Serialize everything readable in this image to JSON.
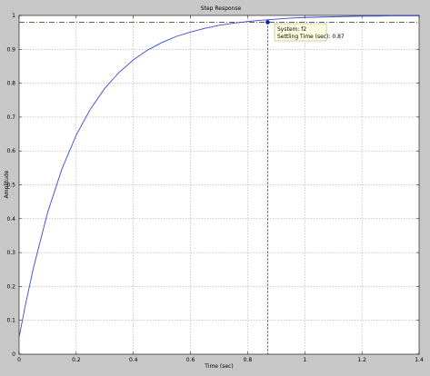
{
  "chart_data": {
    "type": "line",
    "title": "Step Response",
    "xlabel": "Time (sec)",
    "ylabel": "Amplitude",
    "xlim": [
      0,
      1.4
    ],
    "ylim": [
      0,
      1
    ],
    "xticks": [
      0,
      0.2,
      0.4,
      0.6,
      0.8,
      1,
      1.2,
      1.4
    ],
    "xtick_labels": [
      "0",
      "0.2",
      "0.4",
      "0.6",
      "0.8",
      "1",
      "1.2",
      "1.4"
    ],
    "yticks": [
      0,
      0.1,
      0.2,
      0.3,
      0.4,
      0.5,
      0.6,
      0.7,
      0.8,
      0.9,
      1
    ],
    "ytick_labels": [
      "0",
      "0.1",
      "0.2",
      "0.3",
      "0.4",
      "0.5",
      "0.6",
      "0.7",
      "0.8",
      "0.9",
      "1"
    ],
    "grid": true,
    "series": [
      {
        "color": "#3b4ad6",
        "x": [
          0,
          0.02,
          0.05,
          0.1,
          0.15,
          0.2,
          0.25,
          0.3,
          0.35,
          0.4,
          0.45,
          0.5,
          0.55,
          0.6,
          0.65,
          0.7,
          0.75,
          0.8,
          0.85,
          0.87,
          0.9,
          0.95,
          1.0,
          1.05,
          1.1,
          1.15,
          1.2,
          1.25,
          1.3,
          1.35,
          1.4
        ],
        "y": [
          0.05,
          0.137,
          0.254,
          0.419,
          0.547,
          0.647,
          0.724,
          0.785,
          0.832,
          0.869,
          0.898,
          0.92,
          0.938,
          0.951,
          0.962,
          0.971,
          0.977,
          0.982,
          0.986,
          0.987,
          0.989,
          0.992,
          0.994,
          0.995,
          0.996,
          0.997,
          0.998,
          0.998,
          0.999,
          0.999,
          0.999
        ]
      }
    ],
    "reference_line": {
      "y": 0.98,
      "style": "dash-dot",
      "color": "#4a4a2a"
    },
    "settling_marker": {
      "x": 0.87,
      "y": 0.98,
      "color": "#0b1fb4"
    },
    "tooltip": {
      "line1": "System: f2",
      "line2": "Settling Time (sec): 0.87",
      "background": "#ffffe1"
    }
  }
}
